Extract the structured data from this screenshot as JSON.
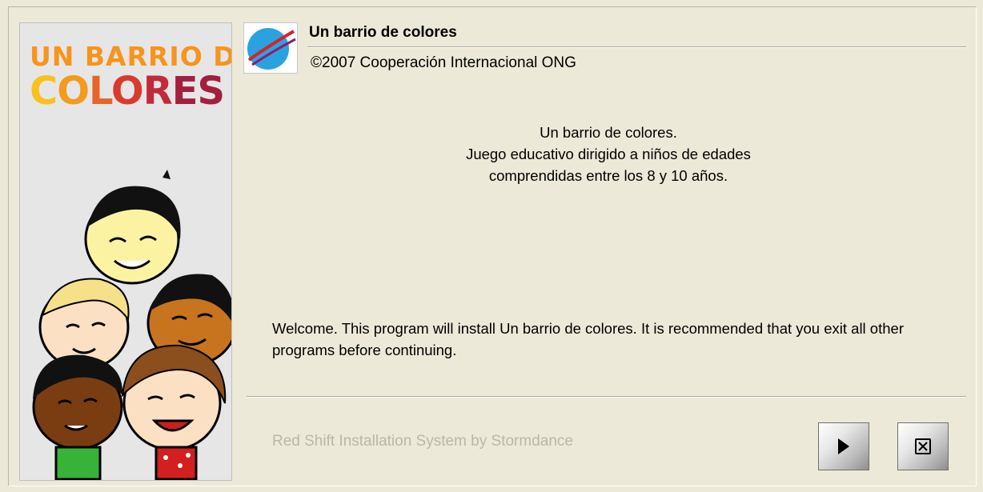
{
  "sidebar": {
    "logo_line1": "UN BARRIO DE",
    "logo_line2_letters": [
      "C",
      "O",
      "L",
      "O",
      "R",
      "E",
      "S"
    ]
  },
  "header": {
    "title": "Un barrio de colores",
    "copyright": "©2007 Cooperación Internacional ONG",
    "app_icon": "globe-swoosh-icon"
  },
  "main": {
    "description": [
      "Un barrio de colores.",
      "Juego educativo dirigido a niños de edades",
      "comprendidas entre los 8 y 10 años."
    ],
    "welcome": "Welcome.  This program will install Un barrio de colores.  It is recommended that you exit all other programs before continuing."
  },
  "footer": {
    "brand": "Red Shift Installation System by Stormdance",
    "next_icon": "play-arrow-icon",
    "cancel_icon": "close-box-icon"
  }
}
